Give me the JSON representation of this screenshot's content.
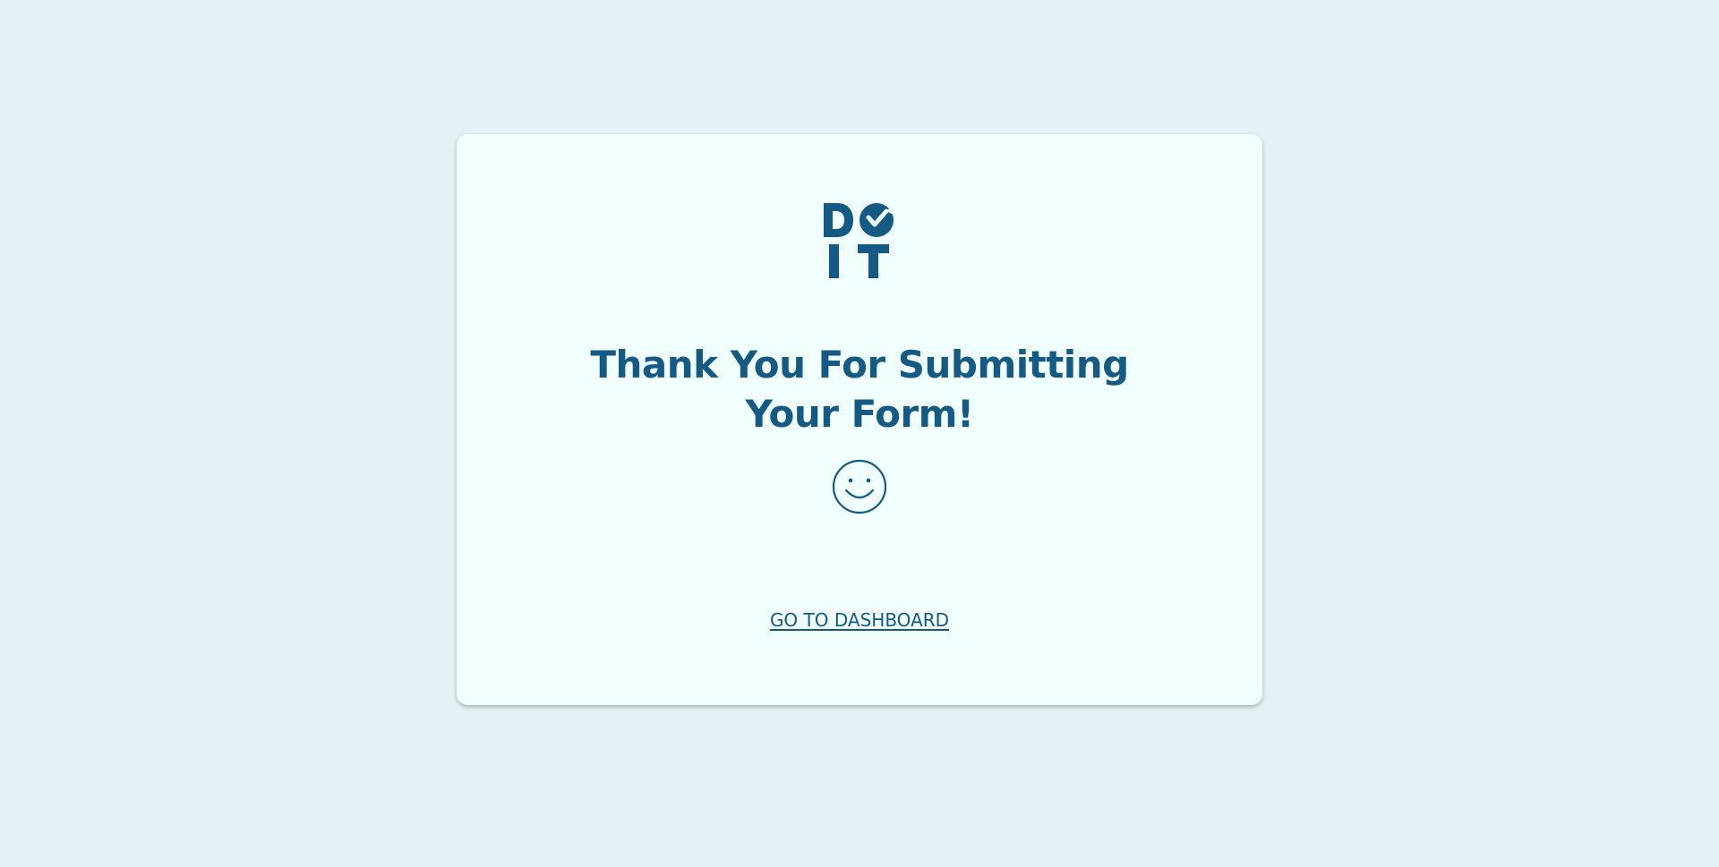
{
  "logo": {
    "alt": "DO IT",
    "icon": "doit-logo-icon",
    "color": "#155a85"
  },
  "main": {
    "title": "Thank You For Submitting Your Form!",
    "smiley_icon": "smiley-face-icon"
  },
  "actions": {
    "dashboard_label": "GO TO DASHBOARD"
  },
  "colors": {
    "background": "#e4f2f6",
    "card": "#f1fefe",
    "brand": "#155a85"
  }
}
